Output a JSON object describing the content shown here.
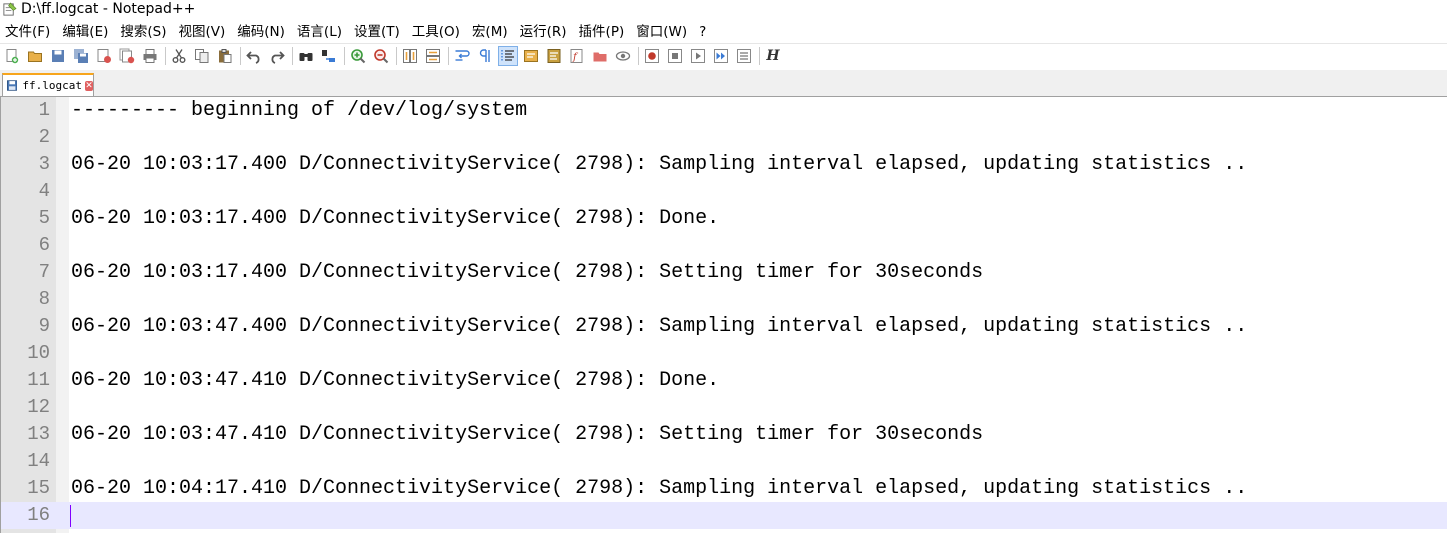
{
  "window": {
    "title": "D:\\ff.logcat - Notepad++"
  },
  "menu": {
    "items": [
      "文件(F)",
      "编辑(E)",
      "搜索(S)",
      "视图(V)",
      "编码(N)",
      "语言(L)",
      "设置(T)",
      "工具(O)",
      "宏(M)",
      "运行(R)",
      "插件(P)",
      "窗口(W)",
      "?"
    ]
  },
  "toolbar": {
    "buttons": [
      {
        "name": "new-file-icon",
        "color": "#4caf50"
      },
      {
        "name": "open-file-icon",
        "color": "#e8b04a"
      },
      {
        "name": "save-icon",
        "color": "#5a7fb5"
      },
      {
        "name": "save-all-icon",
        "color": "#5a7fb5"
      },
      {
        "name": "close-icon",
        "color": "#d9534f"
      },
      {
        "name": "close-all-icon",
        "color": "#d9534f"
      },
      {
        "name": "print-icon",
        "color": "#777777"
      },
      {
        "sep": true
      },
      {
        "name": "cut-icon",
        "color": "#555555"
      },
      {
        "name": "copy-icon",
        "color": "#777777"
      },
      {
        "name": "paste-icon",
        "color": "#8a6d3b"
      },
      {
        "sep": true
      },
      {
        "name": "undo-icon",
        "color": "#555555"
      },
      {
        "name": "redo-icon",
        "color": "#555555"
      },
      {
        "sep": true
      },
      {
        "name": "find-icon",
        "color": "#333333"
      },
      {
        "name": "replace-icon",
        "color": "#3a7bd5"
      },
      {
        "sep": true
      },
      {
        "name": "zoom-in-icon",
        "color": "#3a9a3a"
      },
      {
        "name": "zoom-out-icon",
        "color": "#c0392b"
      },
      {
        "sep": true
      },
      {
        "name": "sync-vertical-icon",
        "color": "#e8a03a"
      },
      {
        "name": "sync-horizontal-icon",
        "color": "#e8a03a"
      },
      {
        "sep": true
      },
      {
        "name": "word-wrap-icon",
        "color": "#3a7bd5"
      },
      {
        "name": "show-all-chars-icon",
        "color": "#3a7bd5"
      },
      {
        "name": "indent-guide-icon",
        "color": "#3a7bd5",
        "active": true
      },
      {
        "name": "udl-icon",
        "color": "#e8b04a"
      },
      {
        "name": "doc-map-icon",
        "color": "#c8a040"
      },
      {
        "name": "function-list-icon",
        "color": "#c0392b"
      },
      {
        "name": "folder-workspace-icon",
        "color": "#d9534f"
      },
      {
        "name": "monitoring-icon",
        "color": "#777777"
      },
      {
        "sep": true
      },
      {
        "name": "record-macro-icon",
        "color": "#c0392b"
      },
      {
        "name": "stop-record-icon",
        "color": "#777777"
      },
      {
        "name": "play-macro-icon",
        "color": "#777777"
      },
      {
        "name": "run-macro-multiple-icon",
        "color": "#3a7bd5"
      },
      {
        "name": "save-macro-icon",
        "color": "#777777"
      },
      {
        "sep": true
      },
      {
        "name": "hex-h-icon",
        "color": "#333333",
        "text": "H"
      }
    ]
  },
  "tabs": [
    {
      "label": "ff.logcat",
      "close_glyph": "✕"
    }
  ],
  "editor": {
    "current_line": 16,
    "lines": [
      {
        "n": "1",
        "text": "--------- beginning of /dev/log/system"
      },
      {
        "n": "2",
        "text": ""
      },
      {
        "n": "3",
        "text": "06-20 10:03:17.400 D/ConnectivityService( 2798): Sampling interval elapsed, updating statistics .."
      },
      {
        "n": "4",
        "text": ""
      },
      {
        "n": "5",
        "text": "06-20 10:03:17.400 D/ConnectivityService( 2798): Done."
      },
      {
        "n": "6",
        "text": ""
      },
      {
        "n": "7",
        "text": "06-20 10:03:17.400 D/ConnectivityService( 2798): Setting timer for 30seconds"
      },
      {
        "n": "8",
        "text": ""
      },
      {
        "n": "9",
        "text": "06-20 10:03:47.400 D/ConnectivityService( 2798): Sampling interval elapsed, updating statistics .."
      },
      {
        "n": "10",
        "text": ""
      },
      {
        "n": "11",
        "text": "06-20 10:03:47.410 D/ConnectivityService( 2798): Done."
      },
      {
        "n": "12",
        "text": ""
      },
      {
        "n": "13",
        "text": "06-20 10:03:47.410 D/ConnectivityService( 2798): Setting timer for 30seconds"
      },
      {
        "n": "14",
        "text": ""
      },
      {
        "n": "15",
        "text": "06-20 10:04:17.410 D/ConnectivityService( 2798): Sampling interval elapsed, updating statistics .."
      },
      {
        "n": "16",
        "text": ""
      }
    ]
  },
  "colors": {
    "tab_accent": "#f7a51c",
    "current_line_bg": "#e8e8ff",
    "caret": "#8000ff",
    "line_number": "#808080"
  }
}
